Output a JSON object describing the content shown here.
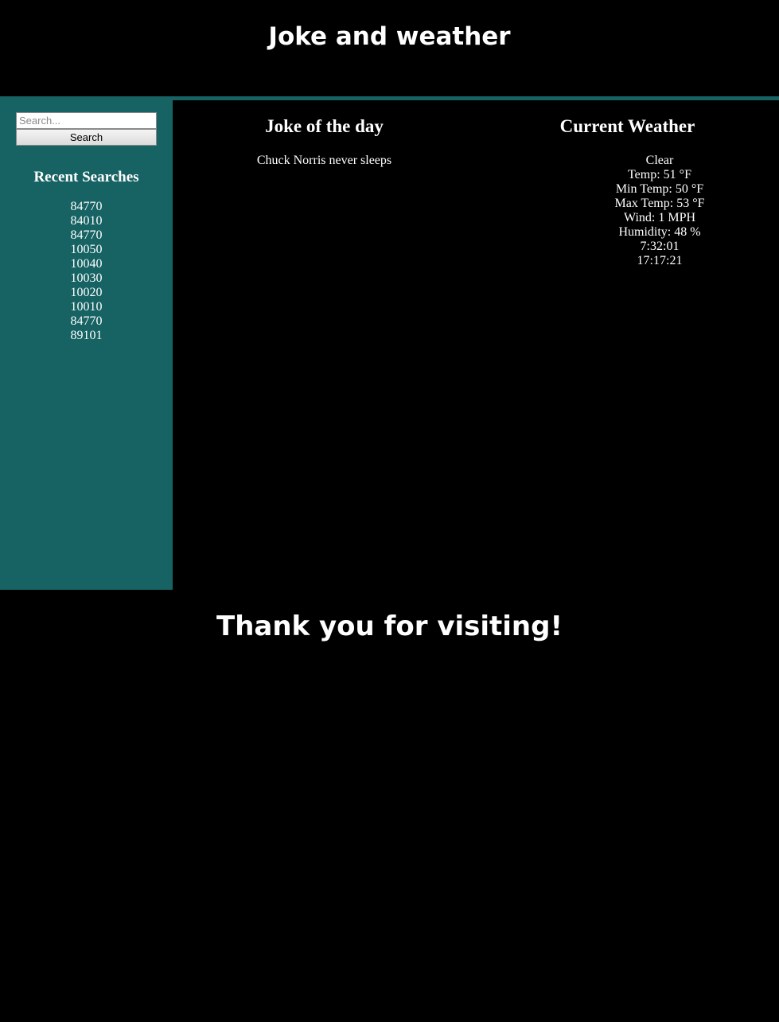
{
  "header": {
    "title": "Joke and weather"
  },
  "sidebar": {
    "search": {
      "placeholder": "Search...",
      "value": "",
      "button_label": "Search"
    },
    "recent_title": "Recent Searches",
    "recent_searches": [
      "84770",
      "84010",
      "84770",
      "10050",
      "10040",
      "10030",
      "10020",
      "10010",
      "84770",
      "89101"
    ]
  },
  "joke": {
    "title": "Joke of the day",
    "text": "Chuck Norris never sleeps"
  },
  "weather": {
    "title": "Current Weather",
    "condition": "Clear",
    "temp": "Temp: 51 °F",
    "min_temp": "Min Temp: 50 °F",
    "max_temp": "Max Temp: 53 °F",
    "wind": "Wind: 1 MPH",
    "humidity": "Humidity: 48 %",
    "sunrise": "7:32:01",
    "sunset": "17:17:21"
  },
  "footer": {
    "text": "Thank you for visiting!"
  },
  "colors": {
    "background": "#000000",
    "accent": "#176263",
    "text": "#ffffff"
  }
}
